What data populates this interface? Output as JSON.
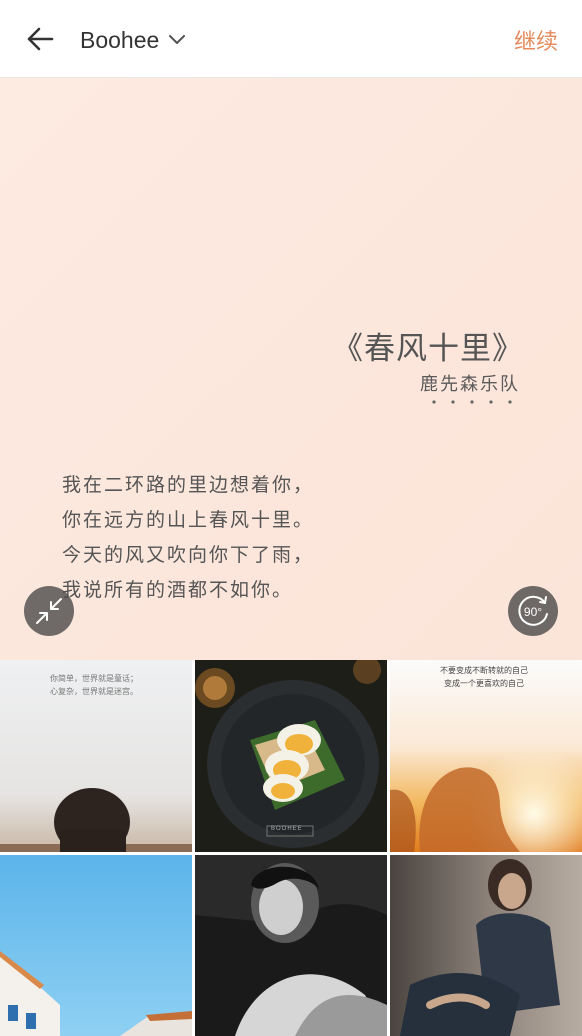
{
  "header": {
    "album_name": "Boohee",
    "continue_label": "继续"
  },
  "preview": {
    "song_title": "《春风十里》",
    "artist": "鹿先森乐队",
    "lyrics": [
      "我在二环路的里边想着你，",
      "你在远方的山上春风十里。",
      "今天的风又吹向你下了雨，",
      "我说所有的酒都不如你。"
    ],
    "rotate_label": "90°"
  },
  "thumbnails": [
    {
      "caption_1": "你简单，世界就是童话；",
      "caption_2": "心复杂，世界就是迷宫。"
    },
    {
      "caption_1": "BOOHEE"
    },
    {
      "caption_1": "不要变成不断转就的自己",
      "caption_2": "变成一个更喜欢的自己"
    },
    {
      "caption_1": ""
    },
    {
      "caption_1": ""
    },
    {
      "caption_1": ""
    }
  ],
  "colors": {
    "accent": "#e58a5b",
    "preview_bg": "#fde9df",
    "overlay_button": "#464646"
  }
}
